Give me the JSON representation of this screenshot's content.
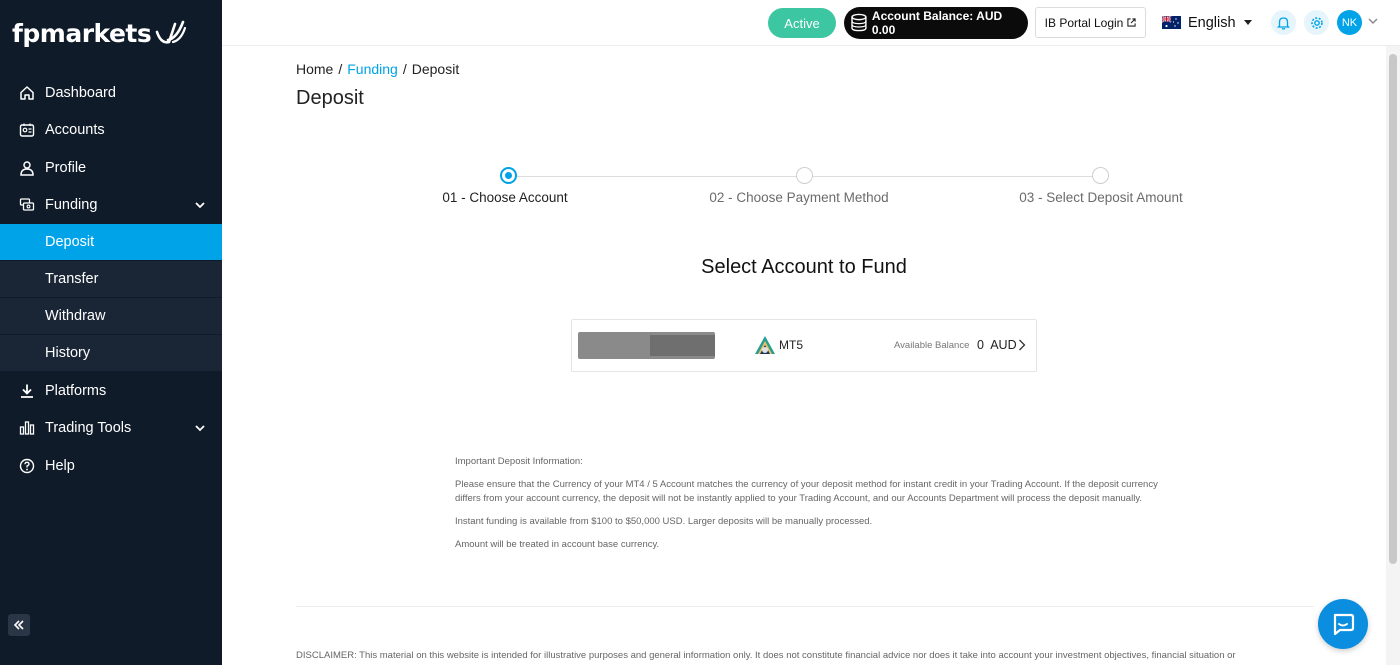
{
  "brand": {
    "logo_text": "fpmarkets"
  },
  "sidebar": {
    "items": [
      {
        "label": "Dashboard",
        "icon": "home-icon"
      },
      {
        "label": "Accounts",
        "icon": "accounts-icon"
      },
      {
        "label": "Profile",
        "icon": "profile-icon"
      },
      {
        "label": "Funding",
        "icon": "funding-icon",
        "expanded": true
      },
      {
        "label": "Platforms",
        "icon": "download-icon"
      },
      {
        "label": "Trading Tools",
        "icon": "chart-bars-icon",
        "expandable": true
      },
      {
        "label": "Help",
        "icon": "help-icon"
      }
    ],
    "funding_sub": [
      "Deposit",
      "Transfer",
      "Withdraw",
      "History"
    ],
    "active_sub": "Deposit"
  },
  "topbar": {
    "status": "Active",
    "balance": "Account Balance: AUD 0.00",
    "ib_portal": "IB Portal Login",
    "language": "English",
    "avatar_initials": "NK"
  },
  "breadcrumb": {
    "home": "Home",
    "funding": "Funding",
    "current": "Deposit"
  },
  "page_title": "Deposit",
  "steps": [
    {
      "label": "01 - Choose Account",
      "active": true
    },
    {
      "label": "02 - Choose Payment Method",
      "active": false
    },
    {
      "label": "03 - Select Deposit Amount",
      "active": false
    }
  ],
  "section_title": "Select Account to Fund",
  "account_card": {
    "platform": "MT5",
    "available_label": "Available Balance",
    "balance_value": "0",
    "currency": "AUD"
  },
  "info": {
    "heading": "Important Deposit Information:",
    "p1": "Please ensure that the Currency of your MT4 / 5 Account matches the currency of your deposit method for instant credit in your Trading Account. If the deposit currency differs from your account currency, the deposit will not be instantly applied to your Trading Account, and our Accounts Department will process the deposit manually.",
    "p2": "Instant funding is available from $100 to $50,000 USD. Larger deposits will be manually processed.",
    "p3": "Amount will be treated in account base currency."
  },
  "disclaimer": "DISCLAIMER: This material on this website is intended for illustrative purposes and general information only. It does not constitute financial advice nor does it take into account your investment objectives, financial situation or",
  "colors": {
    "accent": "#00a3e8",
    "sidebar_bg": "#0f1b29",
    "status_green": "#3cc6a1"
  }
}
